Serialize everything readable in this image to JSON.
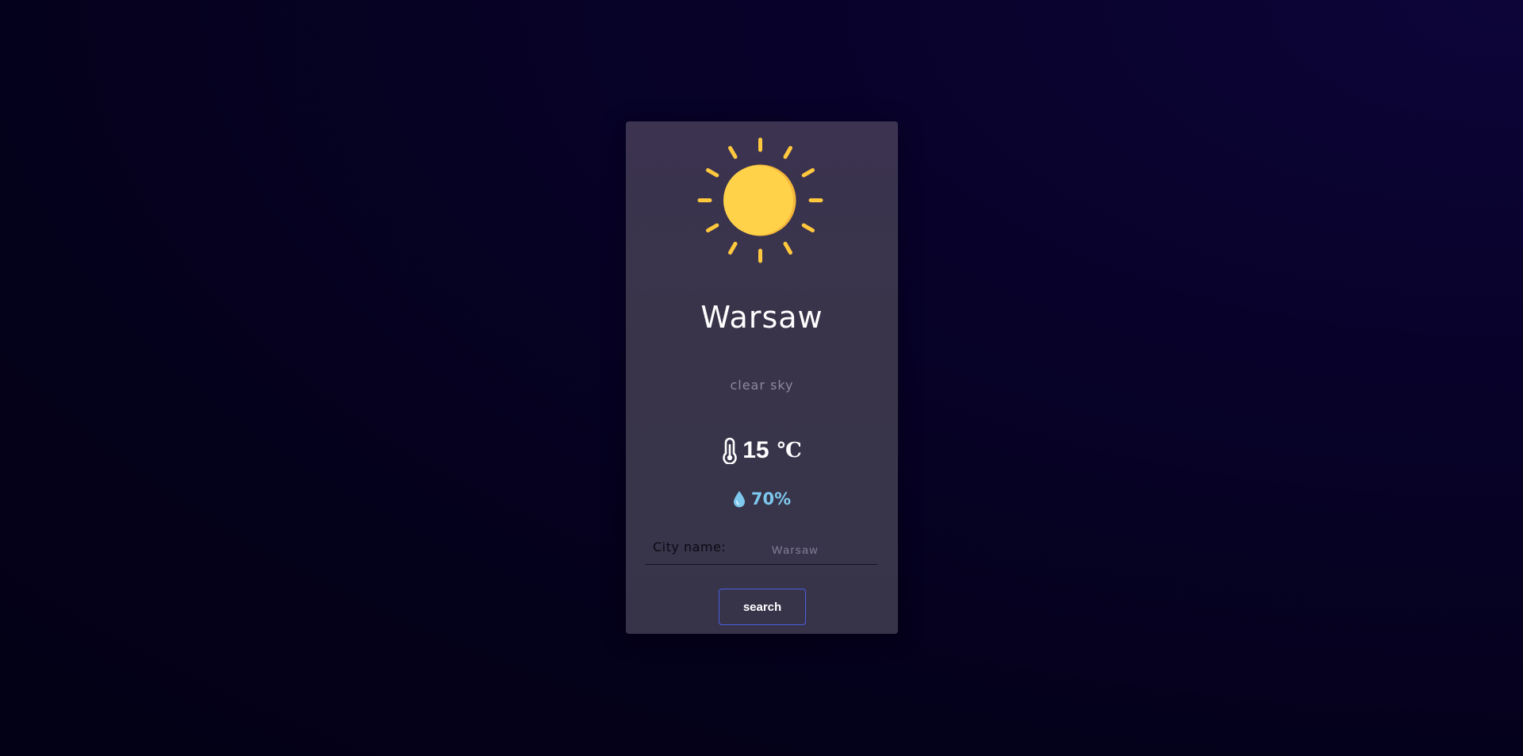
{
  "weather": {
    "icon": "sun-icon",
    "city": "Warsaw",
    "description": "clear sky",
    "temperature": "15",
    "temperature_unit": "℃",
    "temperature_icon": "thermometer-icon",
    "humidity": "70%",
    "humidity_icon": "droplet-icon"
  },
  "search_form": {
    "label": "City name:",
    "placeholder": "Warsaw",
    "button_label": "search"
  },
  "colors": {
    "sun": "#ffd24a",
    "humidity": "#7ec8ee",
    "button_border": "#4b5ee0",
    "card_background": "#3a3449"
  }
}
